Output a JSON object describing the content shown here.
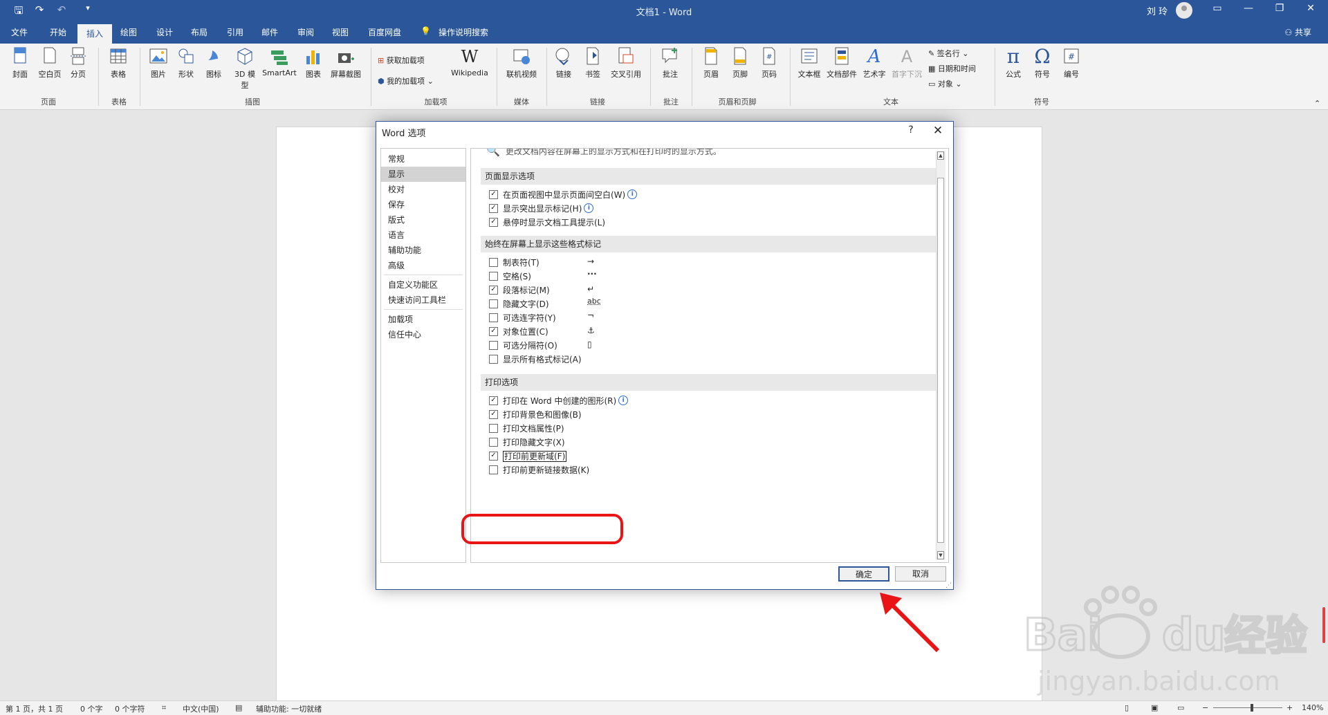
{
  "titlebar": {
    "doc_title": "文档1 - Word",
    "user_name": "刘 玲"
  },
  "menu": {
    "tabs": [
      "文件",
      "开始",
      "插入",
      "绘图",
      "设计",
      "布局",
      "引用",
      "邮件",
      "审阅",
      "视图",
      "百度网盘"
    ],
    "active": "插入",
    "search_hint": "操作说明搜索",
    "share": "共享"
  },
  "ribbon": {
    "buttons": {
      "cover": "封面",
      "blank": "空白页",
      "pagebreak": "分页",
      "table": "表格",
      "picture": "图片",
      "shapes": "形状",
      "icons": "图标",
      "model3d": "3D 模型",
      "smartart": "SmartArt",
      "chart": "图表",
      "screenshot": "屏幕截图",
      "get_addins": "获取加载项",
      "my_addins": "我的加载项",
      "wikipedia": "Wikipedia",
      "online_video": "联机视频",
      "link": "链接",
      "bookmark": "书签",
      "crossref": "交叉引用",
      "comment": "批注",
      "header": "页眉",
      "footer": "页脚",
      "pagenum": "页码",
      "textbox": "文本框",
      "quickparts": "文档部件",
      "wordart": "艺术字",
      "dropcap": "首字下沉",
      "signature": "签名行",
      "datetime": "日期和时间",
      "object": "对象",
      "equation": "公式",
      "symbol": "符号",
      "number": "编号"
    },
    "groups": {
      "pages": "页面",
      "tables": "表格",
      "illustrations": "插图",
      "addins": "加载项",
      "media": "媒体",
      "links": "链接",
      "comments": "批注",
      "headerfooter": "页眉和页脚",
      "text": "文本",
      "symbols": "符号"
    }
  },
  "dialog": {
    "title": "Word 选项",
    "help": "?",
    "close": "✕",
    "nav": [
      "常规",
      "显示",
      "校对",
      "保存",
      "版式",
      "语言",
      "辅助功能",
      "高级",
      "自定义功能区",
      "快速访问工具栏",
      "加载项",
      "信任中心"
    ],
    "nav_selected": "显示",
    "intro": "更改文档内容在屏幕上的显示方式和在打印时的显示方式。",
    "sections": {
      "page_display": "页面显示选项",
      "format_marks": "始终在屏幕上显示这些格式标记",
      "print": "打印选项"
    },
    "page_display_options": [
      {
        "label": "在页面视图中显示页面间空白(W)",
        "checked": true,
        "info": true
      },
      {
        "label": "显示突出显示标记(H)",
        "checked": true,
        "info": true
      },
      {
        "label": "悬停时显示文档工具提示(L)",
        "checked": true,
        "info": false
      }
    ],
    "format_marks_options": [
      {
        "label": "制表符(T)",
        "checked": false,
        "mark": "→"
      },
      {
        "label": "空格(S)",
        "checked": false,
        "mark": "···"
      },
      {
        "label": "段落标记(M)",
        "checked": true,
        "mark": "↵"
      },
      {
        "label": "隐藏文字(D)",
        "checked": false,
        "mark": "abc"
      },
      {
        "label": "可选连字符(Y)",
        "checked": false,
        "mark": "¬"
      },
      {
        "label": "对象位置(C)",
        "checked": true,
        "mark": "⚓"
      },
      {
        "label": "可选分隔符(O)",
        "checked": false,
        "mark": "▯"
      },
      {
        "label": "显示所有格式标记(A)",
        "checked": false,
        "mark": ""
      }
    ],
    "print_options": [
      {
        "label": "打印在 Word 中创建的图形(R)",
        "checked": true,
        "info": true
      },
      {
        "label": "打印背景色和图像(B)",
        "checked": true,
        "info": false
      },
      {
        "label": "打印文档属性(P)",
        "checked": false,
        "info": false
      },
      {
        "label": "打印隐藏文字(X)",
        "checked": false,
        "info": false
      },
      {
        "label": "打印前更新域(F)",
        "checked": true,
        "info": false
      },
      {
        "label": "打印前更新链接数据(K)",
        "checked": false,
        "info": false
      }
    ],
    "ok": "确定",
    "cancel": "取消"
  },
  "status": {
    "page": "第 1 页，共 1 页",
    "words": "0 个字",
    "chars": "0 个字符",
    "lang": "中文(中国)",
    "accessibility": "辅助功能: 一切就绪",
    "zoom": "140%"
  },
  "watermark": {
    "text": "Bai du 经验",
    "url": "jingyan.baidu.com"
  },
  "colors": {
    "accent": "#2b579a",
    "annotation": "#e81416"
  }
}
